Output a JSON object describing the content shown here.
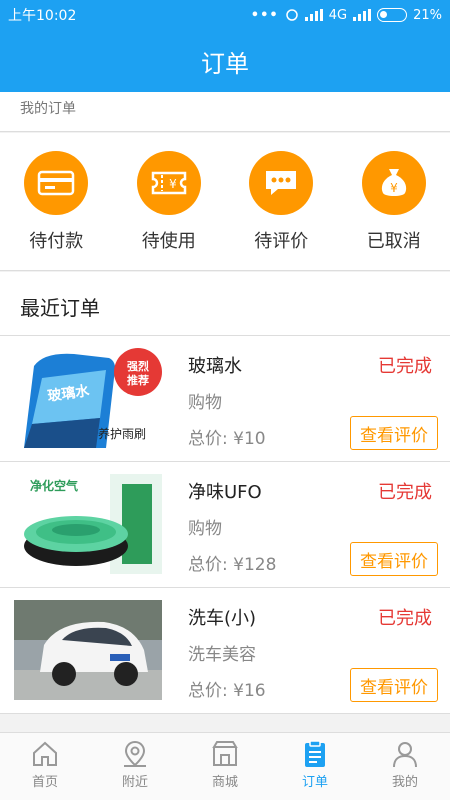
{
  "status_bar": {
    "time": "上午10:02",
    "network": "4G",
    "battery": "21%"
  },
  "header": {
    "title": "订单"
  },
  "section": {
    "my_orders": "我的订单",
    "recent_orders": "最近订单"
  },
  "status_items": [
    {
      "label": "待付款",
      "icon": "card-icon"
    },
    {
      "label": "待使用",
      "icon": "ticket-icon"
    },
    {
      "label": "待评价",
      "icon": "chat-icon"
    },
    {
      "label": "已取消",
      "icon": "money-bag-icon"
    }
  ],
  "orders": [
    {
      "name": "玻璃水",
      "category": "购物",
      "price": "总价: ¥10",
      "status": "已完成",
      "button": "查看评价",
      "image_text": {
        "badge": "强烈推荐",
        "product": "玻璃水",
        "caption": "养护雨刷"
      }
    },
    {
      "name": "净味UFO",
      "category": "购物",
      "price": "总价: ¥128",
      "status": "已完成",
      "button": "查看评价",
      "image_text": {
        "top": "净化空气"
      }
    },
    {
      "name": "洗车(小)",
      "category": "洗车美容",
      "price": "总价: ¥16",
      "status": "已完成",
      "button": "查看评价"
    }
  ],
  "tabs": [
    {
      "label": "首页",
      "icon": "home-icon"
    },
    {
      "label": "附近",
      "icon": "location-icon"
    },
    {
      "label": "商城",
      "icon": "store-icon"
    },
    {
      "label": "订单",
      "icon": "clipboard-icon",
      "active": true
    },
    {
      "label": "我的",
      "icon": "user-icon"
    }
  ],
  "colors": {
    "primary": "#1da1f2",
    "accent": "#ff9800",
    "status_done": "#e53935"
  }
}
